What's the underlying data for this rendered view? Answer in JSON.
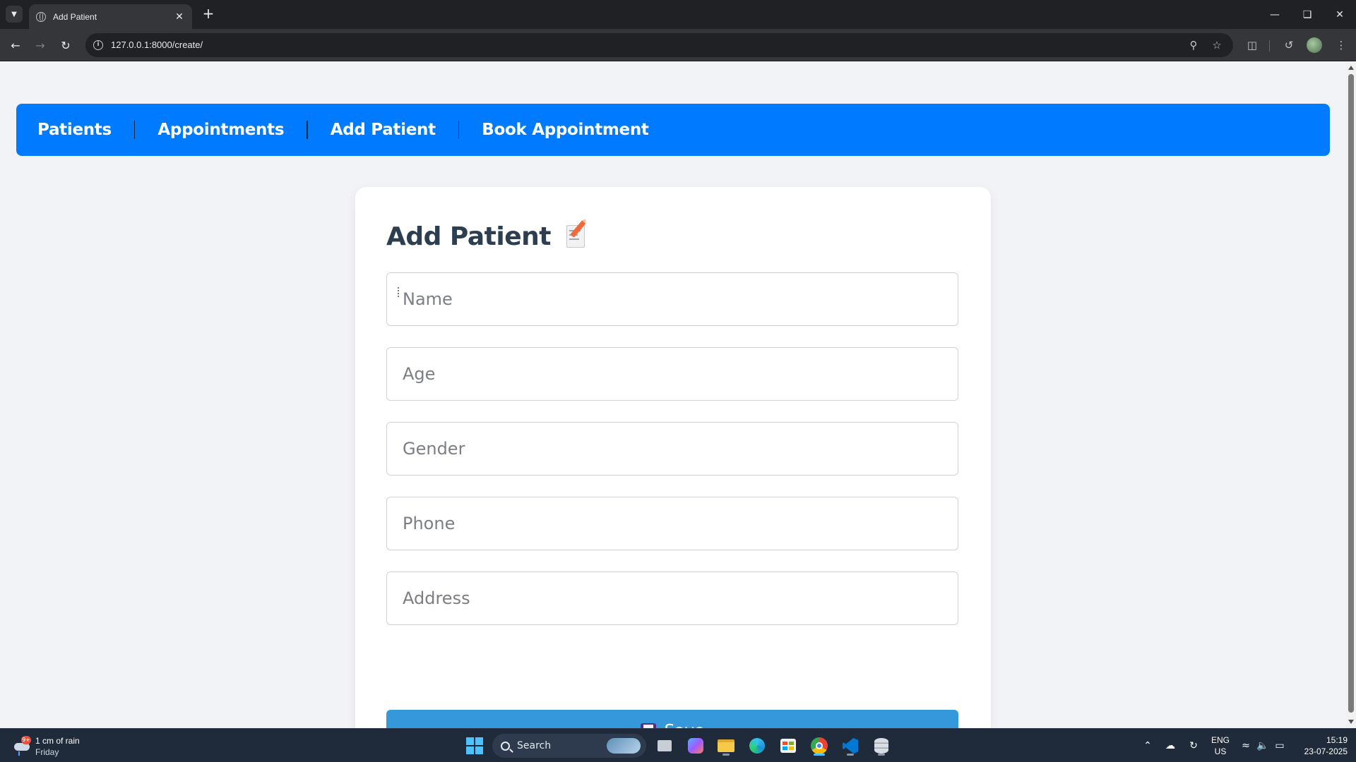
{
  "browser": {
    "tab_title": "Add Patient",
    "url": "127.0.0.1:8000/create/"
  },
  "navbar": {
    "links": [
      "Patients",
      "Appointments",
      "Add Patient",
      "Book Appointment"
    ]
  },
  "form": {
    "title": "Add Patient",
    "title_icon": "memo-icon",
    "fields": [
      {
        "name": "name",
        "placeholder": "Name",
        "value": ""
      },
      {
        "name": "age",
        "placeholder": "Age",
        "value": ""
      },
      {
        "name": "gender",
        "placeholder": "Gender",
        "value": ""
      },
      {
        "name": "phone",
        "placeholder": "Phone",
        "value": ""
      },
      {
        "name": "address",
        "placeholder": "Address",
        "value": ""
      }
    ],
    "submit_label": "Save",
    "submit_icon": "floppy-disk-icon"
  },
  "colors": {
    "navbar_bg": "#007bff",
    "button_bg": "#3498db",
    "title_color": "#2c3e50",
    "page_bg": "#f2f3f7"
  },
  "taskbar": {
    "weather_line1": "1 cm of rain",
    "weather_line2": "Friday",
    "weather_badge": "9+",
    "search_label": "Search",
    "lang_line1": "ENG",
    "lang_line2": "US",
    "time": "15:19",
    "date": "23-07-2025"
  }
}
